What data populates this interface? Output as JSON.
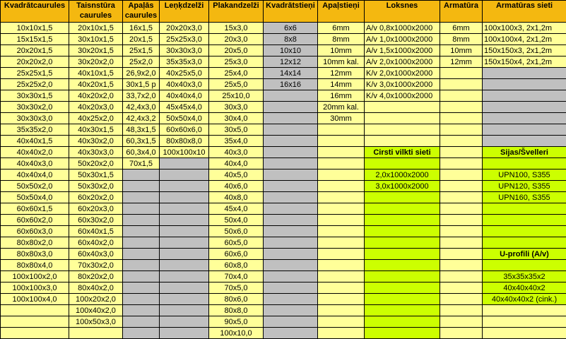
{
  "headers": [
    "Kvadrātcaurules",
    "Taisnstūra caurules",
    "Apaļās caurules",
    "Leņķdzelži",
    "Plakandzelži",
    "Kvadrātstieņi",
    "Apaļstieņi",
    "Loksnes",
    "Armatūra",
    "Armatūras sieti"
  ],
  "kvadratcaurules": [
    "10x10x1,5",
    "15x15x1,5",
    "20x20x1,5",
    "20x20x2,0",
    "25x25x1,5",
    "25x25x2,0",
    "30x30x1,5",
    "30x30x2,0",
    "30x30x3,0",
    "35x35x2,0",
    "40x40x1,5",
    "40x40x2,0",
    "40x40x3,0",
    "40x40x4,0",
    "50x50x2,0",
    "50x50x4,0",
    "60x60x1,5",
    "60x60x2,0",
    "60x60x3,0",
    "80x80x2,0",
    "80x80x3,0",
    "80x80x4,0",
    "100x100x2,0",
    "100x100x3,0",
    "100x100x4,0",
    "",
    ""
  ],
  "taisnstura": [
    "20x10x1,5",
    "30x10x1,5",
    "30x20x1,5",
    "30x20x2,0",
    "40x10x1,5",
    "40x20x1,5",
    "40x20x2,0",
    "40x20x3,0",
    "40x25x2,0",
    "40x30x1,5",
    "40x30x2,0",
    "40x30x3,0",
    "50x20x2,0",
    "50x30x1,5",
    "50x30x2,0",
    "60x20x2,0",
    "60x20x3,0",
    "60x30x2,0",
    "60x40x1,5",
    "60x40x2,0",
    "60x40x3,0",
    "70x30x2,0",
    "80x20x2,0",
    "80x40x2,0",
    "100x20x2,0",
    "100x40x2,0",
    "100x50x3,0"
  ],
  "apalas": [
    "16x1,5",
    "20x1,5",
    "25x1,5",
    "25x2,0",
    "26,9x2,0",
    "30x1,5 p",
    "33,7x2,0",
    "42,4x3,0",
    "42,4x3,2",
    "48,3x1,5",
    "60,3x1,5",
    "60,3x4,0",
    "70x1,5"
  ],
  "lenkdzelzi": [
    "20x20x3,0",
    "25x25x3,0",
    "30x30x3,0",
    "35x35x3,0",
    "40x25x5,0",
    "40x40x3,0",
    "40x40x4,0",
    "45x45x4,0",
    "50x50x4,0",
    "60x60x6,0",
    "80x80x8,0",
    "100x100x10"
  ],
  "plakandzelzi": [
    "15x3,0",
    "20x3,0",
    "20x5,0",
    "25x3,0",
    "25x4,0",
    "25x5,0",
    "25x10,0",
    "30x3,0",
    "30x4,0",
    "30x5,0",
    "35x4,0",
    "40x3,0",
    "40x4,0",
    "40x5,0",
    "40x6,0",
    "40x8,0",
    "45x4,0",
    "50x4,0",
    "50x6,0",
    "60x5,0",
    "60x6,0",
    "60x8,0",
    "70x4,0",
    "70x5,0",
    "80x6,0",
    "80x8,0",
    "90x5,0",
    "100x10,0"
  ],
  "kvadratstieni": [
    "6x6",
    "8x8",
    "10x10",
    "12x12",
    "14x14",
    "16x16"
  ],
  "apalstieni": [
    "6mm",
    "8mm",
    "10mm",
    "10mm kal.",
    "12mm",
    "14mm",
    "16mm",
    "20mm kal.",
    "30mm"
  ],
  "loksnes": [
    "A/v 0,8x1000x2000",
    "A/v 1,0x1000x2000",
    "A/v 1,5x1000x2000",
    "A/v 2,0x1000x2000",
    "K/v 2,0x1000x2000",
    "K/v 3,0x1000x2000",
    "K/v 4,0x1000x2000"
  ],
  "cirsti_title": "Cirsti vilkti sieti",
  "cirsti": [
    "2,0x1000x2000",
    "3,0x1000x2000"
  ],
  "armatura": [
    "6mm",
    "8mm",
    "10mm",
    "12mm"
  ],
  "sieti": [
    "100x100x3, 2x1,2m",
    "100x100x4, 2x1,2m",
    "150x150x3, 2x1,2m",
    "150x150x4, 2x1,2m"
  ],
  "sijas_title": "Sijas/Švelleri",
  "sijas": [
    "UPN100, S355",
    "UPN120, S355",
    "UPN160, S355"
  ],
  "uprofili_title": "U-profili (A/v)",
  "uprofili": [
    "35x35x35x2",
    "40x40x40x2",
    "40x40x40x2 (cink.)"
  ]
}
